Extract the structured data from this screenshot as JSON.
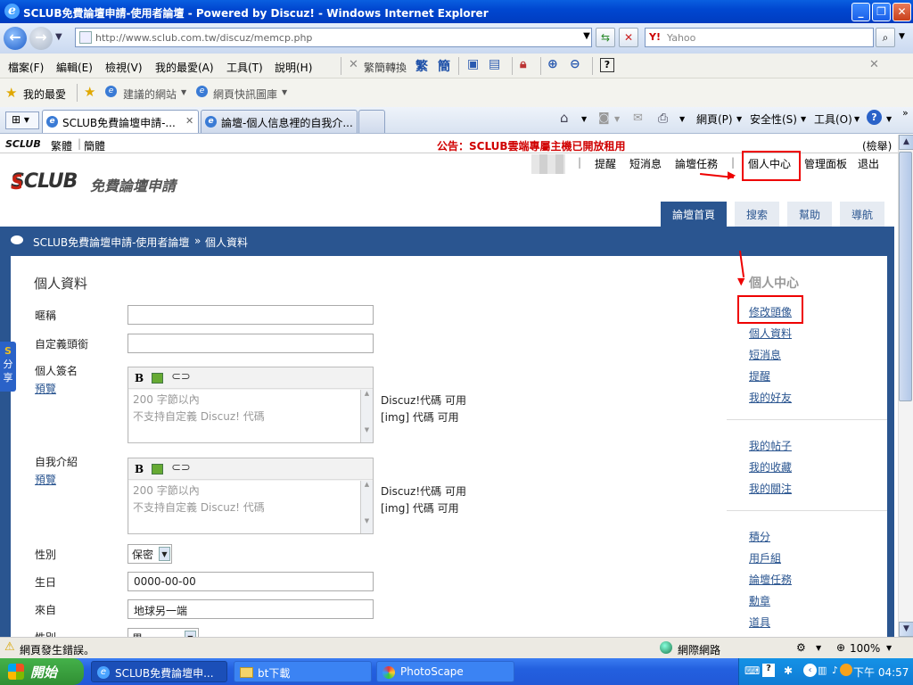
{
  "window": {
    "title": "SCLUB免費論壇申請-使用者論壇 - Powered by Discuz! - Windows Internet Explorer"
  },
  "address": {
    "url": "http://www.sclub.com.tw/discuz/memcp.php",
    "search_placeholder": "Yahoo",
    "search_brand": "Y!"
  },
  "menu": {
    "items": [
      "檔案(F)",
      "編輯(E)",
      "檢視(V)",
      "我的最愛(A)",
      "工具(T)",
      "說明(H)"
    ],
    "convert_label": "繁簡轉換",
    "trad": "繁",
    "simp": "簡"
  },
  "favorites": {
    "label": "我的最愛",
    "suggested": "建議的網站",
    "webslice": "網頁快訊圖庫"
  },
  "tabs": {
    "active": "SCLUB免費論壇申請-...",
    "second": "論壇-個人信息裡的自我介..."
  },
  "commands": {
    "page": "網頁(P)",
    "safety": "安全性(S)",
    "tools": "工具(O)"
  },
  "site": {
    "lang_trad": "繁體",
    "lang_simp": "簡體",
    "notice": "公告：SCLUB雲端專屬主機已開放租用",
    "report": "(檢舉)",
    "logo_text": "SCLUB",
    "logo_sub": "免費論壇申請",
    "top_links": [
      "提醒",
      "短消息",
      "論壇任務",
      "個人中心",
      "管理面板",
      "退出"
    ],
    "nav_tabs": [
      "論壇首頁",
      "搜索",
      "幫助",
      "導航"
    ],
    "breadcrumb_forum": "SCLUB免費論壇申請-使用者論壇",
    "breadcrumb_sep": "»",
    "breadcrumb_page": "個人資料"
  },
  "form": {
    "heading": "個人資料",
    "nickname_label": "暱稱",
    "custom_title_label": "自定義頭銜",
    "signature_label": "個人簽名",
    "preview_link": "預覽",
    "sig_line1": "200 字節以內",
    "sig_line2": "不支持自定義 Discuz! 代碼",
    "discuz_hint": "Discuz!代碼 可用",
    "img_hint": "[img] 代碼 可用",
    "intro_label": "自我介紹",
    "gender_label": "性別",
    "gender_value": "保密",
    "birthday_label": "生日",
    "birthday_value": "0000-00-00",
    "from_label": "來自",
    "from_value": "地球另一端",
    "gender2_label": "性別",
    "gender2_value": "男",
    "editor_bold": "B"
  },
  "sidebar": {
    "heading": "個人中心",
    "group1": [
      "修改頭像",
      "個人資料",
      "短消息",
      "提醒",
      "我的好友"
    ],
    "group2": [
      "我的帖子",
      "我的收藏",
      "我的關注"
    ],
    "group3": [
      "積分",
      "用戶組",
      "論壇任務",
      "勳章",
      "道具"
    ]
  },
  "share": {
    "label1": "分",
    "label2": "享",
    "s": "S"
  },
  "status": {
    "error": "網頁發生錯誤。",
    "zone": "網際網路",
    "zoom": "100%"
  },
  "taskbar": {
    "start": "開始",
    "tasks": [
      "SCLUB免費論壇申...",
      "bt下載",
      "PhotoScape"
    ],
    "clock": "下午 04:57"
  },
  "colors": {
    "forum_blue": "#2a5590",
    "highlight_red": "#e00000",
    "notice_red": "#d00000"
  }
}
